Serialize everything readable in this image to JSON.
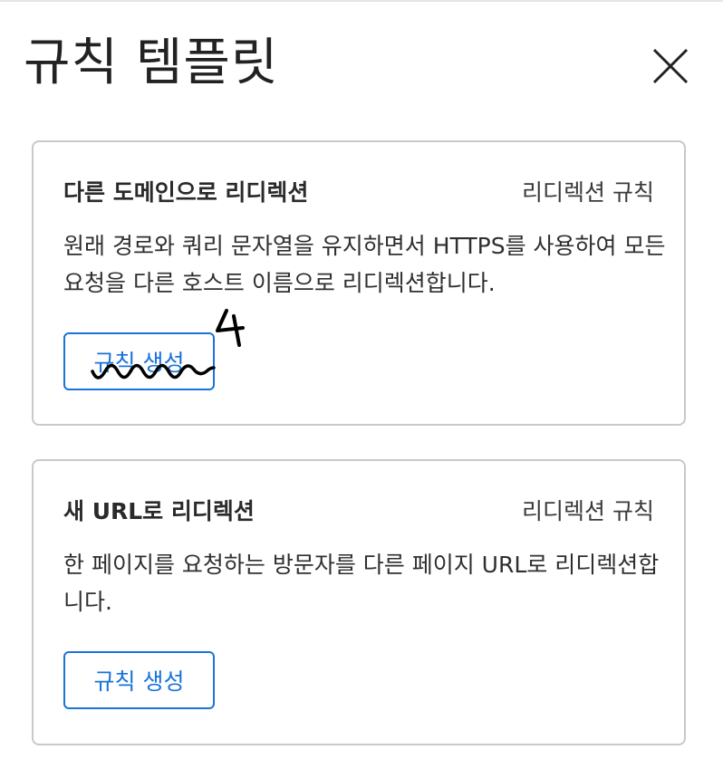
{
  "panel": {
    "title": "규칙 템플릿"
  },
  "templates": [
    {
      "title": "다른 도메인으로 리디렉션",
      "type": "리디렉션 규칙",
      "description": "원래 경로와 쿼리 문자열을 유지하면서 HTTPS를 사용하여 모든 요청을 다른 호스트 이름으로 리디렉션합니다.",
      "button_label": "규칙 생성"
    },
    {
      "title": "새 URL로 리디렉션",
      "type": "리디렉션 규칙",
      "description": "한 페이지를 요청하는 방문자를 다른 페이지 URL로 리디렉션합니다.",
      "button_label": "규칙 생성"
    }
  ],
  "annotation": {
    "mark": "4"
  },
  "colors": {
    "accent": "#1a73d9",
    "border": "#c9c9c9",
    "annotation": "#000000"
  }
}
